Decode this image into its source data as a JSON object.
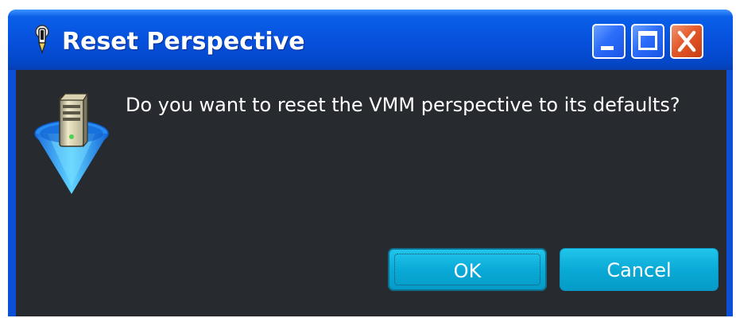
{
  "dialog": {
    "title": "Reset Perspective",
    "message": "Do you want to reset the VMM perspective to its defaults?",
    "ok_label": "OK",
    "cancel_label": "Cancel"
  },
  "icons": {
    "title_icon": "app-pen-icon",
    "dialog_icon": "vmm-server-cone-icon",
    "minimize": "minimize-icon",
    "maximize": "maximize-icon",
    "close": "close-icon"
  },
  "colors": {
    "titlebar": "#0650dc",
    "body": "#272b30",
    "button": "#0aaad6",
    "close_button": "#e35a2c"
  }
}
